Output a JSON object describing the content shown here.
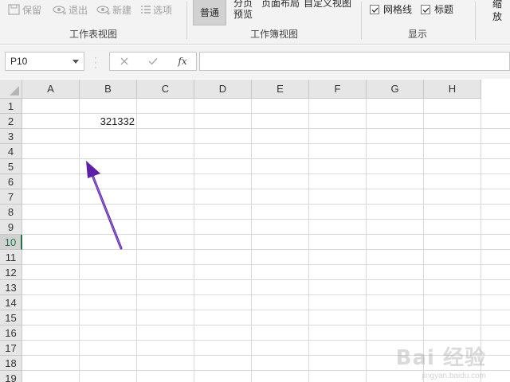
{
  "ribbon": {
    "workbook_view_group": {
      "buttons": [
        {
          "label": "保留",
          "icon": "save-icon"
        },
        {
          "label": "退出",
          "icon": "exit-view-icon"
        },
        {
          "label": "新建",
          "icon": "new-view-icon"
        },
        {
          "label": "选项",
          "icon": "options-icon"
        }
      ],
      "group_label": "工作表视图"
    },
    "workbook_views": {
      "normal_label": "普通",
      "page_break_label_1": "分页",
      "page_break_label_2": "预览",
      "page_layout_label": "页面布局",
      "custom_view_label": "自定义视图",
      "group_label": "工作簿视图"
    },
    "show": {
      "gridlines_label": "网格线",
      "gridlines_checked": true,
      "headings_label": "标题",
      "headings_checked": true,
      "group_label": "显示"
    },
    "zoom": {
      "label_1": "缩",
      "label_2": "放"
    }
  },
  "formula_bar": {
    "name_box": "P10",
    "formula": "",
    "fx_label": "fx"
  },
  "grid": {
    "columns": [
      "A",
      "B",
      "C",
      "D",
      "E",
      "F",
      "G",
      "H"
    ],
    "rows": [
      "1",
      "2",
      "3",
      "4",
      "5",
      "6",
      "7",
      "8",
      "9",
      "10",
      "11",
      "12",
      "13",
      "14",
      "15",
      "16",
      "17",
      "18",
      "19"
    ],
    "active_row": "10",
    "cells": [
      {
        "ref": "B2",
        "value": "321332"
      }
    ]
  },
  "watermark": {
    "text": "Bai 经验",
    "sub": "jingyan.baidu.com"
  },
  "colors": {
    "accent_green": "#217346",
    "arrow_purple": "#5b1fa8"
  }
}
